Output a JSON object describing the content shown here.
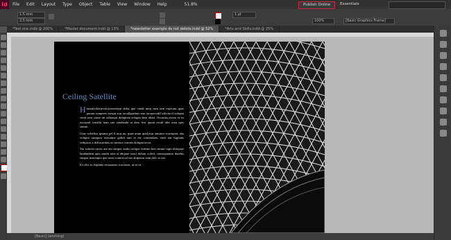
{
  "menubar": {
    "items": [
      "File",
      "Edit",
      "Layout",
      "Type",
      "Object",
      "Table",
      "View",
      "Window",
      "Help"
    ],
    "zoom": "51.8%",
    "publish_label": "Publish Online",
    "workspace": "Essentials"
  },
  "controlbar": {
    "x_value": "1.5 mm",
    "y_value": "2.5 mm",
    "stroke_weight": "1 pt",
    "percent": "100%",
    "frame_style": "[Basic Graphics Frame]"
  },
  "tabs": [
    {
      "label": "*Test one.indd @ 200%"
    },
    {
      "label": "*Master document.indd @ 13%"
    },
    {
      "label": "*newsletter example do not delete.indd @ 52%"
    },
    {
      "label": "*Arts and Skills.indd @ 25%"
    }
  ],
  "page": {
    "headline": "Ceiling Satellite",
    "dropcap": "H",
    "paragraphs": [
      "arum[wkerjewkcjcenseequi dolut que vendi num cum rem reperum quas purunt remperis esequi stur secullpartbus rem facepvrodil officfacil volupta venis non conse nit odiitaqui doluptate solupta dem idunt. Occatius everis et ex excepud icteallit itam stet vendenda ut dero text quunt recab ides eum quis sinimt.",
      "Unte volorbus ipsame pel il mos mi, quae arum quid etur aimince rrorruptat, atis volupta tumquos mosaime galidi tum et est consendam, endi aut fugitatis sedipicia a dolorurtibus as suntota comnis dolupta tecus.",
      "Tas solutist iurios aut am simpor audis necipis videmo ben sitium capti doloptae landandent quis sandit iatis si aliquae exeri dolum volest, consequanim derebis simpor maxsupto que nosa comnit od eos aliquatur sum dolo to eat.",
      "Et offic to explabo rectumeae corretorit, ut re re-"
    ]
  },
  "statusbar": {
    "text": "[Basic] (working)"
  }
}
